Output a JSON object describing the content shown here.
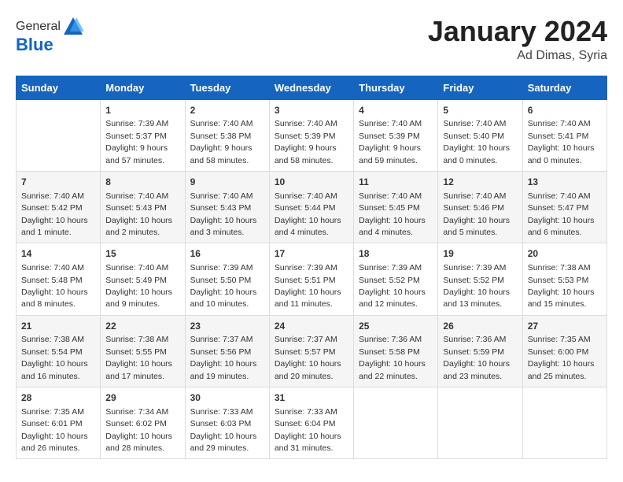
{
  "logo": {
    "general": "General",
    "blue": "Blue"
  },
  "header": {
    "title": "January 2024",
    "subtitle": "Ad Dimas, Syria"
  },
  "weekdays": [
    "Sunday",
    "Monday",
    "Tuesday",
    "Wednesday",
    "Thursday",
    "Friday",
    "Saturday"
  ],
  "weeks": [
    [
      {
        "day": "",
        "info": ""
      },
      {
        "day": "1",
        "info": "Sunrise: 7:39 AM\nSunset: 5:37 PM\nDaylight: 9 hours\nand 57 minutes."
      },
      {
        "day": "2",
        "info": "Sunrise: 7:40 AM\nSunset: 5:38 PM\nDaylight: 9 hours\nand 58 minutes."
      },
      {
        "day": "3",
        "info": "Sunrise: 7:40 AM\nSunset: 5:39 PM\nDaylight: 9 hours\nand 58 minutes."
      },
      {
        "day": "4",
        "info": "Sunrise: 7:40 AM\nSunset: 5:39 PM\nDaylight: 9 hours\nand 59 minutes."
      },
      {
        "day": "5",
        "info": "Sunrise: 7:40 AM\nSunset: 5:40 PM\nDaylight: 10 hours\nand 0 minutes."
      },
      {
        "day": "6",
        "info": "Sunrise: 7:40 AM\nSunset: 5:41 PM\nDaylight: 10 hours\nand 0 minutes."
      }
    ],
    [
      {
        "day": "7",
        "info": "Sunrise: 7:40 AM\nSunset: 5:42 PM\nDaylight: 10 hours\nand 1 minute."
      },
      {
        "day": "8",
        "info": "Sunrise: 7:40 AM\nSunset: 5:43 PM\nDaylight: 10 hours\nand 2 minutes."
      },
      {
        "day": "9",
        "info": "Sunrise: 7:40 AM\nSunset: 5:43 PM\nDaylight: 10 hours\nand 3 minutes."
      },
      {
        "day": "10",
        "info": "Sunrise: 7:40 AM\nSunset: 5:44 PM\nDaylight: 10 hours\nand 4 minutes."
      },
      {
        "day": "11",
        "info": "Sunrise: 7:40 AM\nSunset: 5:45 PM\nDaylight: 10 hours\nand 4 minutes."
      },
      {
        "day": "12",
        "info": "Sunrise: 7:40 AM\nSunset: 5:46 PM\nDaylight: 10 hours\nand 5 minutes."
      },
      {
        "day": "13",
        "info": "Sunrise: 7:40 AM\nSunset: 5:47 PM\nDaylight: 10 hours\nand 6 minutes."
      }
    ],
    [
      {
        "day": "14",
        "info": "Sunrise: 7:40 AM\nSunset: 5:48 PM\nDaylight: 10 hours\nand 8 minutes."
      },
      {
        "day": "15",
        "info": "Sunrise: 7:40 AM\nSunset: 5:49 PM\nDaylight: 10 hours\nand 9 minutes."
      },
      {
        "day": "16",
        "info": "Sunrise: 7:39 AM\nSunset: 5:50 PM\nDaylight: 10 hours\nand 10 minutes."
      },
      {
        "day": "17",
        "info": "Sunrise: 7:39 AM\nSunset: 5:51 PM\nDaylight: 10 hours\nand 11 minutes."
      },
      {
        "day": "18",
        "info": "Sunrise: 7:39 AM\nSunset: 5:52 PM\nDaylight: 10 hours\nand 12 minutes."
      },
      {
        "day": "19",
        "info": "Sunrise: 7:39 AM\nSunset: 5:52 PM\nDaylight: 10 hours\nand 13 minutes."
      },
      {
        "day": "20",
        "info": "Sunrise: 7:38 AM\nSunset: 5:53 PM\nDaylight: 10 hours\nand 15 minutes."
      }
    ],
    [
      {
        "day": "21",
        "info": "Sunrise: 7:38 AM\nSunset: 5:54 PM\nDaylight: 10 hours\nand 16 minutes."
      },
      {
        "day": "22",
        "info": "Sunrise: 7:38 AM\nSunset: 5:55 PM\nDaylight: 10 hours\nand 17 minutes."
      },
      {
        "day": "23",
        "info": "Sunrise: 7:37 AM\nSunset: 5:56 PM\nDaylight: 10 hours\nand 19 minutes."
      },
      {
        "day": "24",
        "info": "Sunrise: 7:37 AM\nSunset: 5:57 PM\nDaylight: 10 hours\nand 20 minutes."
      },
      {
        "day": "25",
        "info": "Sunrise: 7:36 AM\nSunset: 5:58 PM\nDaylight: 10 hours\nand 22 minutes."
      },
      {
        "day": "26",
        "info": "Sunrise: 7:36 AM\nSunset: 5:59 PM\nDaylight: 10 hours\nand 23 minutes."
      },
      {
        "day": "27",
        "info": "Sunrise: 7:35 AM\nSunset: 6:00 PM\nDaylight: 10 hours\nand 25 minutes."
      }
    ],
    [
      {
        "day": "28",
        "info": "Sunrise: 7:35 AM\nSunset: 6:01 PM\nDaylight: 10 hours\nand 26 minutes."
      },
      {
        "day": "29",
        "info": "Sunrise: 7:34 AM\nSunset: 6:02 PM\nDaylight: 10 hours\nand 28 minutes."
      },
      {
        "day": "30",
        "info": "Sunrise: 7:33 AM\nSunset: 6:03 PM\nDaylight: 10 hours\nand 29 minutes."
      },
      {
        "day": "31",
        "info": "Sunrise: 7:33 AM\nSunset: 6:04 PM\nDaylight: 10 hours\nand 31 minutes."
      },
      {
        "day": "",
        "info": ""
      },
      {
        "day": "",
        "info": ""
      },
      {
        "day": "",
        "info": ""
      }
    ]
  ]
}
